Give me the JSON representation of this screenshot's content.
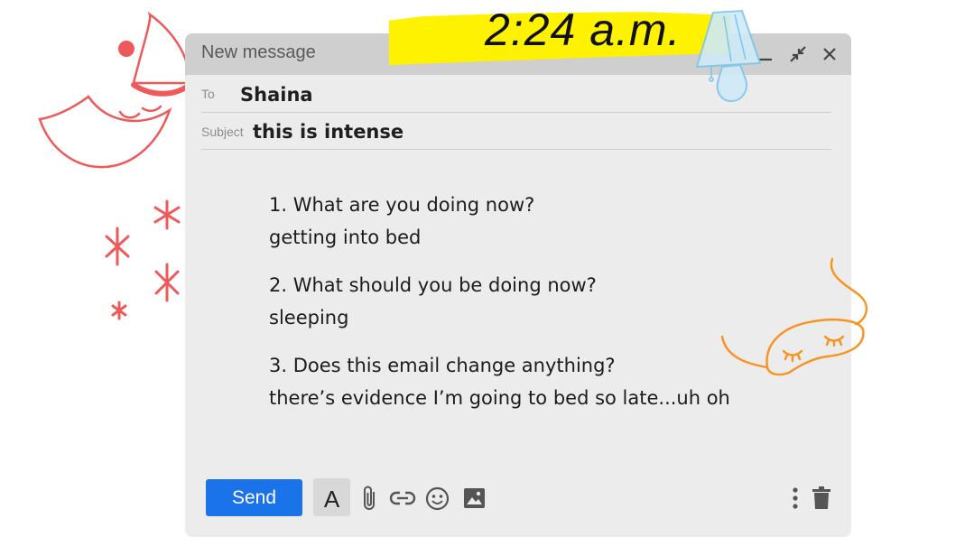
{
  "banner": {
    "time": "2:24 a.m."
  },
  "window": {
    "title": "New message",
    "controls": {
      "minimize": "minimize-icon",
      "exit_fullscreen": "exit-fullscreen-icon",
      "close": "close-icon"
    }
  },
  "fields": {
    "to_label": "To",
    "to_value": "Shaina",
    "subject_label": "Subject",
    "subject_value": "this is intense"
  },
  "message": {
    "items": [
      {
        "question": "1. What are you doing now?",
        "answer": "getting into bed"
      },
      {
        "question": "2. What should you be doing now?",
        "answer": "sleeping"
      },
      {
        "question": "3. Does this email change anything?",
        "answer": "there’s evidence I’m going to bed so late...uh oh"
      }
    ]
  },
  "toolbar": {
    "send_label": "Send",
    "format_label": "A",
    "icons": [
      "attach-icon",
      "link-icon",
      "emoji-icon",
      "image-icon",
      "more-options-icon",
      "trash-icon"
    ]
  },
  "colors": {
    "send": "#1a73e8",
    "highlight": "#fff200",
    "moon": "#ee5a5a",
    "mask": "#f7931e",
    "lamp": "#7fc6ec"
  }
}
